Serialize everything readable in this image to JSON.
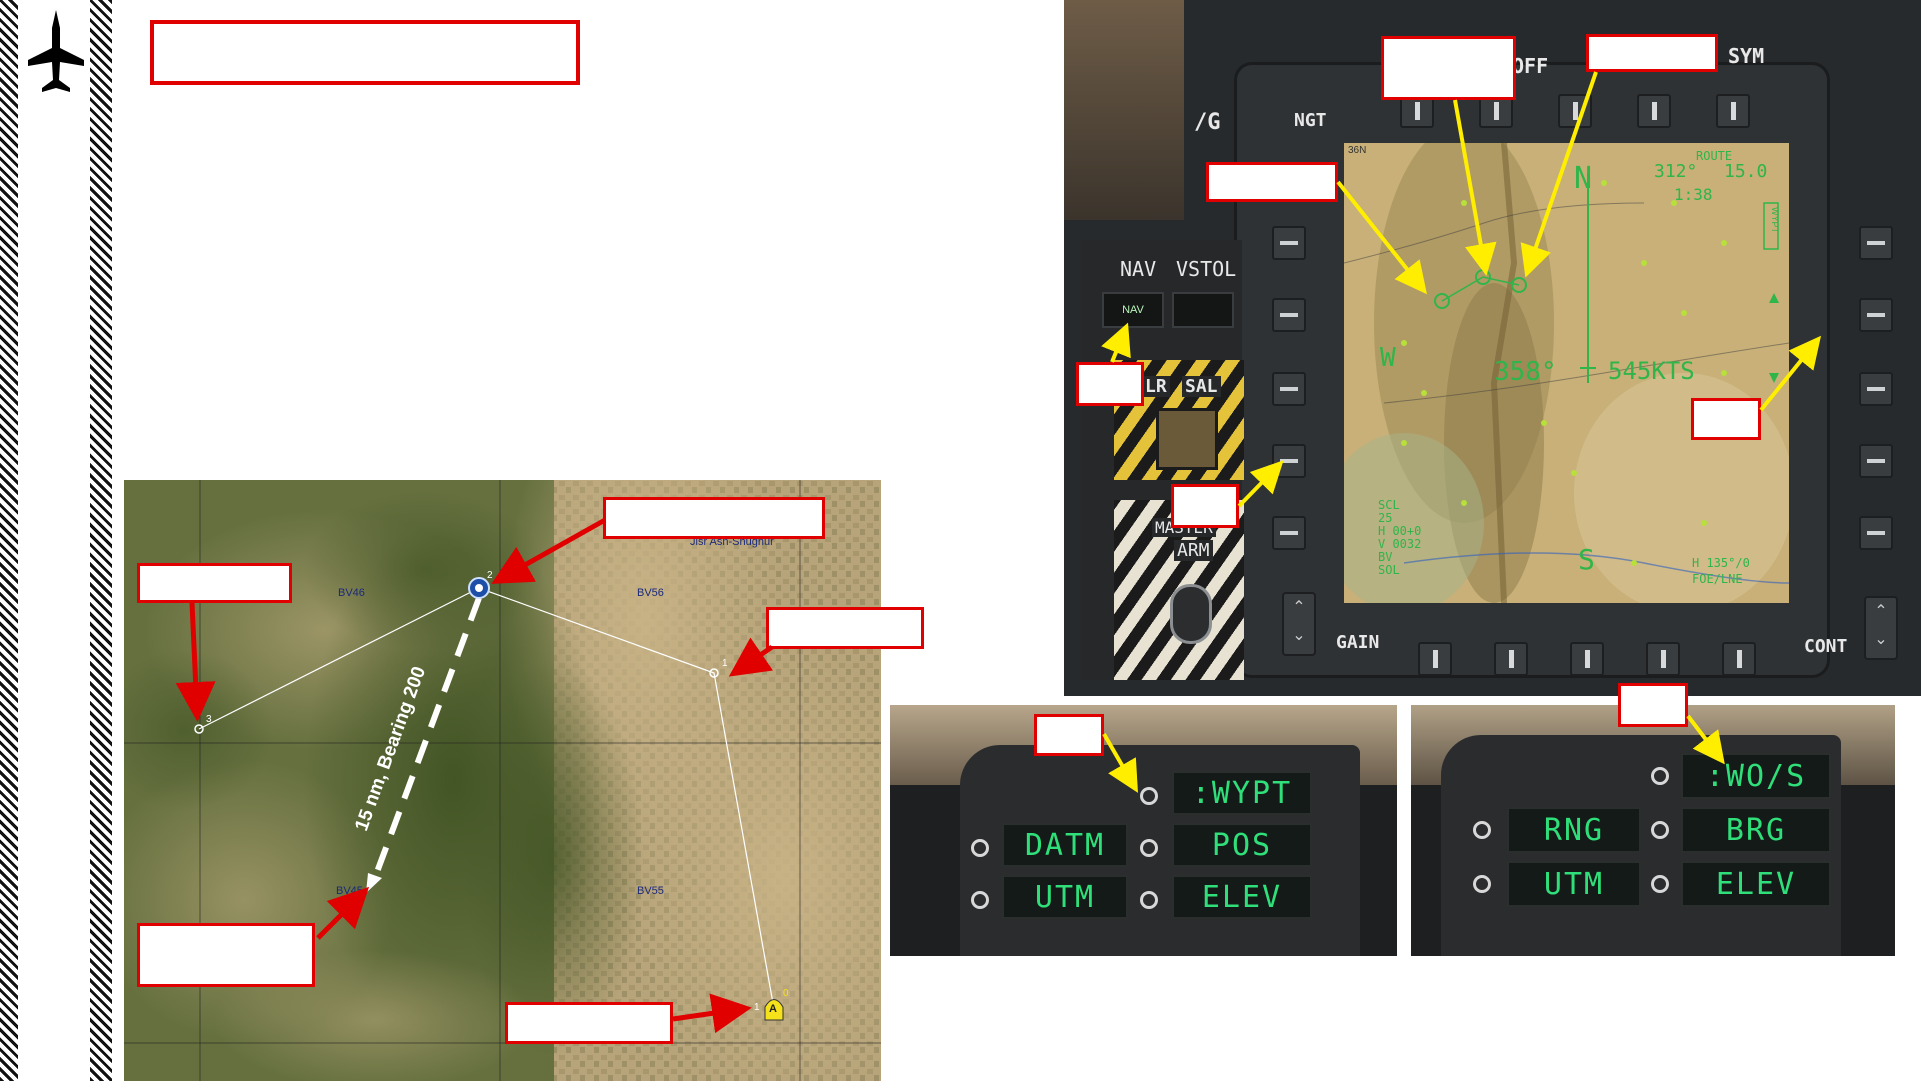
{
  "colors": {
    "callout_border": "#e00000",
    "leader_red": "#e00000",
    "leader_yellow": "#ffee00",
    "ufc_text": "#2fe07a",
    "route_line": "#ffffff",
    "steerpoint_blue": "#1e4fa8",
    "start_marker_yellow": "#f5e21a"
  },
  "sidebar": {
    "icon": "aircraft-icon"
  },
  "mfd": {
    "top_labels": {
      "off": "OFF",
      "sym": "SYM"
    },
    "left_labels": {
      "g": "/G",
      "ngt": "NGT"
    },
    "bottom_labels": {
      "gain": "GAIN",
      "cont": "CONT"
    },
    "panel_labels": {
      "nav": "NAV",
      "vstol": "VSTOL",
      "nav_button": "NAV",
      "lr": "LR",
      "sal": "SAL",
      "master": "MASTER",
      "arm": "ARM"
    },
    "display": {
      "heading": "358°",
      "speed": "545KTS",
      "cardinal_n": "N",
      "cardinal_w": "W",
      "cardinal_s": "S",
      "route_label": "ROUTE",
      "range": "15.0",
      "bearing": "312°",
      "time": "1:38",
      "bl_lines": [
        "SCL",
        "25",
        "H 00+0",
        "V 0032",
        "BV",
        "SOL"
      ],
      "br_lines": [
        "H 135°/0",
        "FOE/LNE"
      ],
      "top_left": "36N",
      "wypt_tag": "WYPT"
    }
  },
  "map": {
    "grid_labels": [
      "BV46",
      "BV56",
      "BV45",
      "BV55"
    ],
    "town_label": "Jisr Ash-Shughur",
    "distance_label": "15 nm, Bearing 200",
    "waypoints": [
      "0",
      "1",
      "2",
      "3"
    ],
    "start_marker": "A",
    "start_index": "1"
  },
  "ufc_left": {
    "windows": [
      ":WYPT",
      "DATM",
      "POS",
      "UTM",
      "ELEV"
    ]
  },
  "ufc_right": {
    "windows": [
      ":WO/S",
      "RNG",
      "BRG",
      "UTM",
      "ELEV"
    ]
  }
}
